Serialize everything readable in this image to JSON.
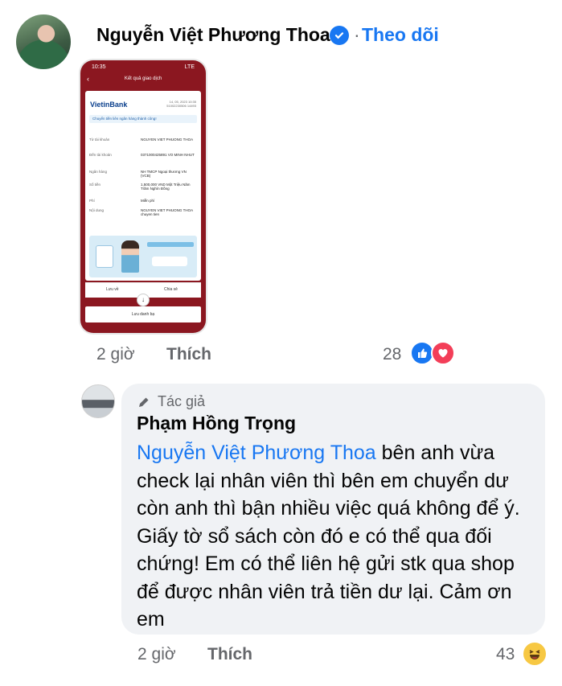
{
  "post": {
    "author": "Nguyễn Việt Phương Thoa",
    "separator": "·",
    "follow_label": "Theo dõi",
    "time": "2 giờ",
    "like_label": "Thích",
    "reaction_count": "28",
    "reactions": [
      "like-icon",
      "heart-icon"
    ]
  },
  "screenshot": {
    "status_time": "10:35",
    "status_right": "LTE",
    "header": "Kết quả giao dịch",
    "bank": "VietinBank",
    "date_line1": "14, 05, 2023 10:35",
    "date_line2": "51002230506 14493",
    "success": "Chuyển tiền liên ngân hàng thành công!",
    "rows": [
      {
        "label": "Từ tài khoản",
        "value": "NGUYEN VIET PHUONG THOA"
      },
      {
        "label": "Đến tài khoản",
        "value": "0371000425891 VO MINH NHUT"
      },
      {
        "label": "Ngân hàng",
        "value": "NH TMCP Ngoại thương VN (VCB)"
      },
      {
        "label": "Số tiền",
        "value": "1,500,000 VND Một Triệu Năm Trăm Nghìn Đồng"
      },
      {
        "label": "Phí",
        "value": "Miễn phí"
      },
      {
        "label": "Nội dung",
        "value": "NGUYEN VIET PHUONG THOA chuyen tien"
      }
    ],
    "action_left": "Lưu về",
    "action_right": "Chia sẻ",
    "save_button": "Lưu danh bạ"
  },
  "comment": {
    "author_tag": "Tác giả",
    "author": "Phạm Hồng Trọng",
    "mention": "Nguyễn Việt Phương Thoa",
    "text": " bên anh vừa check lại nhân viên thì bên em chuyển dư còn anh thì bận nhiều việc quá không để ý. Giấy tờ sổ sách còn đó e có thể qua đối chứng! Em có thể liên hệ  gửi stk qua shop để được nhân viên trả tiền dư lại. Cảm ơn em",
    "time": "2 giờ",
    "like_label": "Thích",
    "reaction_count": "43",
    "reactions": [
      "haha-icon"
    ]
  },
  "colors": {
    "accent": "#1877f2",
    "meta": "#65676b",
    "bubble": "#f0f2f5",
    "heart": "#f33e58",
    "haha": "#f7c843",
    "bank_red": "#8b1720"
  }
}
